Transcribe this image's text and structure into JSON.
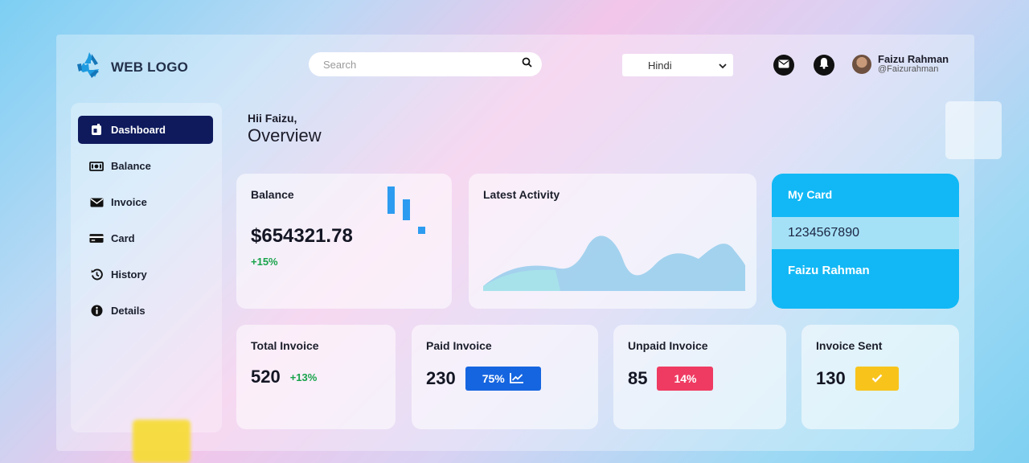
{
  "header": {
    "logo_text": "WEB LOGO",
    "search_placeholder": "Search",
    "language": "Hindi",
    "user_name": "Faizu Rahman",
    "user_handle": "@Faizurahman"
  },
  "sidebar": {
    "items": [
      {
        "label": "Dashboard",
        "active": true,
        "icon": "dashboard-icon"
      },
      {
        "label": "Balance",
        "icon": "money-icon"
      },
      {
        "label": "Invoice",
        "icon": "envelope-icon"
      },
      {
        "label": "Card",
        "icon": "credit-card-icon"
      },
      {
        "label": "History",
        "icon": "history-icon"
      },
      {
        "label": "Details",
        "icon": "info-icon"
      }
    ]
  },
  "main": {
    "greeting": "Hii Faizu,",
    "heading": "Overview",
    "balance": {
      "title": "Balance",
      "amount": "$654321.78",
      "change": "+15%"
    },
    "activity": {
      "title": "Latest Activity"
    },
    "my_card": {
      "title": "My Card",
      "number": "1234567890",
      "name": "Faizu Rahman"
    },
    "invoices": [
      {
        "title": "Total Invoice",
        "value": "520",
        "badge": "+13%"
      },
      {
        "title": "Paid Invoice",
        "value": "230",
        "badge": "75%",
        "color": "#1565e0"
      },
      {
        "title": "Unpaid Invoice",
        "value": "85",
        "badge": "14%",
        "color": "#ef3b62"
      },
      {
        "title": "Invoice Sent",
        "value": "130",
        "color": "#f8c41c"
      }
    ]
  },
  "colors": {
    "accent": "#0e1a5c",
    "card": "#12b8f5",
    "positive": "#18a34a"
  }
}
